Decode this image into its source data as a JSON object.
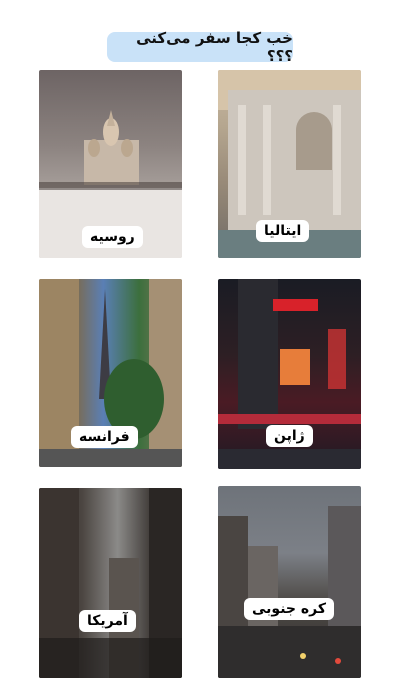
{
  "story": {
    "title": "خب کجا سفر می‌کنی ؟؟؟"
  },
  "destinations": [
    {
      "id": "russia",
      "label": "روسیه"
    },
    {
      "id": "italy",
      "label": "ایتالیا"
    },
    {
      "id": "france",
      "label": "فرانسه"
    },
    {
      "id": "japan",
      "label": "ژاپن"
    },
    {
      "id": "usa",
      "label": "آمریکا"
    },
    {
      "id": "korea",
      "label": "کره جنوبی"
    }
  ]
}
